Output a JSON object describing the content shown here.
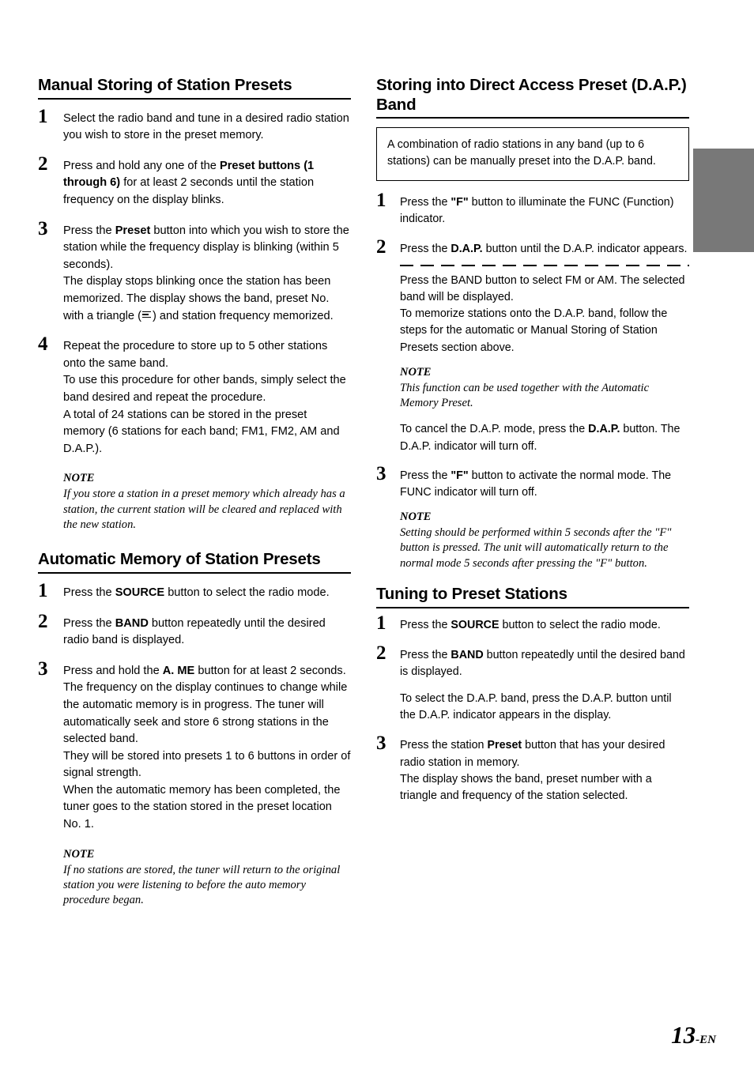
{
  "page": {
    "folio_number": "13",
    "folio_suffix": "-EN",
    "edge_tab_color": "#787878"
  },
  "left_column": {
    "sections": [
      {
        "heading": "Manual Storing of Station Presets",
        "steps": [
          {
            "number": "1",
            "paragraphs": [
              "Select the radio band and tune in a desired radio station you wish to store in the preset memory."
            ]
          },
          {
            "number": "2",
            "rich": true,
            "text_parts": [
              "Press and hold any one of the ",
              "Preset buttons (1 through 6)",
              " for at least 2 seconds until the station frequency on the display blinks."
            ]
          },
          {
            "number": "3",
            "rich": true,
            "text_parts": [
              "Press the ",
              "Preset",
              " button into which you wish to store the station while the frequency display is blinking (within 5 seconds)."
            ],
            "continuation_pre": "The display stops blinking once the station has been memorized. The display shows the band, preset No. with a triangle (",
            "continuation_post": ") and station frequency memorized."
          },
          {
            "number": "4",
            "paragraphs": [
              "Repeat the procedure to store up to 5 other stations onto the same band.",
              "To use this procedure for other bands, simply select the band desired and repeat the procedure.",
              "A total of 24 stations can be stored in the preset memory (6 stations for each band; FM1, FM2, AM and D.A.P.)."
            ]
          }
        ],
        "note": {
          "title": "NOTE",
          "body": "If you store a station in a preset memory which already has a station, the current station will be cleared and replaced with the new station."
        }
      },
      {
        "heading": "Automatic Memory of Station Presets",
        "steps": [
          {
            "number": "1",
            "rich": true,
            "text_parts": [
              "Press the ",
              "SOURCE",
              " button to select the radio mode."
            ]
          },
          {
            "number": "2",
            "rich": true,
            "text_parts": [
              "Press the ",
              "BAND",
              " button repeatedly until the desired radio band is displayed."
            ]
          },
          {
            "number": "3",
            "rich": true,
            "text_parts": [
              "Press and hold the ",
              "A. ME",
              " button for at least 2 seconds."
            ],
            "paragraphs": [
              "The frequency on the display continues to change while the automatic memory is in progress. The tuner will automatically seek and store 6 strong stations in the selected band.",
              "They will be stored into presets 1 to 6 buttons in order of signal strength.",
              "When the automatic memory has been completed, the tuner goes to the station stored in the preset location No. 1."
            ]
          }
        ],
        "note": {
          "title": "NOTE",
          "body": "If no stations are stored, the tuner will return to the original station you were listening to before the auto memory procedure began."
        }
      }
    ]
  },
  "right_column": {
    "sections": [
      {
        "heading": "Storing into Direct Access Preset (D.A.P.) Band",
        "boxed_text": "A combination of radio stations in any band (up to 6 stations) can be manually preset into the D.A.P. band.",
        "steps": [
          {
            "number": "1",
            "rich": true,
            "text_parts": [
              "Press the ",
              "\"F\"",
              " button to illuminate the FUNC (Function) indicator."
            ]
          },
          {
            "number": "2",
            "rich": true,
            "text_parts": [
              "Press the ",
              "D.A.P.",
              " button until the D.A.P. indicator appears."
            ],
            "after_dash_paragraphs": [
              "Press the BAND button to select FM or AM. The selected band will be displayed.",
              "To memorize stations onto the D.A.P. band, follow the steps for the automatic or Manual Storing of Station Presets section above."
            ],
            "note": {
              "title": "NOTE",
              "body": "This function can be used together with the Automatic Memory Preset."
            },
            "cancel_parts": [
              "To cancel the D.A.P. mode, press the ",
              "D.A.P.",
              " button. The D.A.P. indicator will turn off."
            ]
          },
          {
            "number": "3",
            "rich": true,
            "text_parts": [
              "Press the ",
              "\"F\"",
              " button to activate the normal mode. The FUNC indicator will turn off."
            ],
            "note": {
              "title": "NOTE",
              "body": "Setting should be performed within 5 seconds after the \"F\" button is pressed. The unit will automatically return to the normal mode 5 seconds after pressing the \"F\" button."
            }
          }
        ]
      },
      {
        "heading": "Tuning to Preset Stations",
        "steps": [
          {
            "number": "1",
            "rich": true,
            "text_parts": [
              "Press the ",
              "SOURCE",
              " button to select the radio mode."
            ]
          },
          {
            "number": "2",
            "rich": true,
            "text_parts": [
              "Press the ",
              "BAND",
              " button repeatedly until the desired band is displayed."
            ],
            "gap_paragraph": "To select the D.A.P. band, press the D.A.P. button until the D.A.P. indicator appears in the display."
          },
          {
            "number": "3",
            "rich": true,
            "text_parts": [
              "Press the station ",
              "Preset",
              " button that has your desired radio station in memory."
            ],
            "paragraphs": [
              "The display shows the band, preset number with a triangle and frequency of the station selected."
            ]
          }
        ]
      }
    ]
  }
}
